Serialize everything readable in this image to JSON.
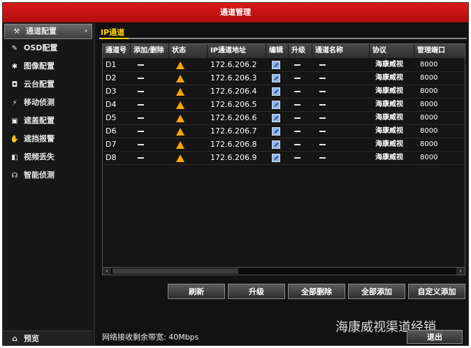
{
  "title": "通道管理",
  "sidebar": {
    "items": [
      {
        "label": "通道配置",
        "icon": "wrench-icon",
        "glyph": "⚒",
        "chevron": "›"
      },
      {
        "label": "OSD配置",
        "icon": "pencil-icon",
        "glyph": "✎"
      },
      {
        "label": "图像配置",
        "icon": "image-icon",
        "glyph": "✱"
      },
      {
        "label": "云台配置",
        "icon": "ptz-icon",
        "glyph": "◘"
      },
      {
        "label": "移动侦测",
        "icon": "running-person-icon",
        "glyph": "⚡"
      },
      {
        "label": "遮盖配置",
        "icon": "mask-icon",
        "glyph": "▣"
      },
      {
        "label": "遮挡报警",
        "icon": "hand-icon",
        "glyph": "✋"
      },
      {
        "label": "视频丢失",
        "icon": "video-loss-icon",
        "glyph": "◧"
      },
      {
        "label": "智能侦测",
        "icon": "smart-detect-icon",
        "glyph": "☊"
      }
    ],
    "preview": {
      "label": "预览",
      "icon": "home-icon",
      "glyph": "⌂"
    }
  },
  "tab": {
    "label": "IP通道"
  },
  "table": {
    "headers": [
      "通道号",
      "添加/删除",
      "状态",
      "IP通道地址",
      "编辑",
      "升级",
      "通道名称",
      "协议",
      "管理端口"
    ],
    "rows": [
      {
        "channel": "D1",
        "ip": "172.6.206.2",
        "protocol": "海康威视",
        "port": "8000"
      },
      {
        "channel": "D2",
        "ip": "172.6.206.3",
        "protocol": "海康威视",
        "port": "8000"
      },
      {
        "channel": "D3",
        "ip": "172.6.206.4",
        "protocol": "海康威视",
        "port": "8000"
      },
      {
        "channel": "D4",
        "ip": "172.6.206.5",
        "protocol": "海康威视",
        "port": "8000"
      },
      {
        "channel": "D5",
        "ip": "172.6.206.6",
        "protocol": "海康威视",
        "port": "8000"
      },
      {
        "channel": "D6",
        "ip": "172.6.206.7",
        "protocol": "海康威视",
        "port": "8000"
      },
      {
        "channel": "D7",
        "ip": "172.6.206.8",
        "protocol": "海康威视",
        "port": "8000"
      },
      {
        "channel": "D8",
        "ip": "172.6.206.9",
        "protocol": "海康威视",
        "port": "8000"
      }
    ]
  },
  "scroll": {
    "left": "‹",
    "right": "›"
  },
  "buttons": {
    "refresh": "刷新",
    "upgrade": "升级",
    "delete_all": "全部删除",
    "add_all": "全部添加",
    "custom_add": "自定义添加"
  },
  "bandwidth": "网络接收剩余带宽: 40Mbps",
  "watermark": "海康威视渠道经销",
  "exit": "退出",
  "colors": {
    "title_bar": "#c81010",
    "tab_accent": "#ffd400",
    "warning": "#f5a800"
  }
}
